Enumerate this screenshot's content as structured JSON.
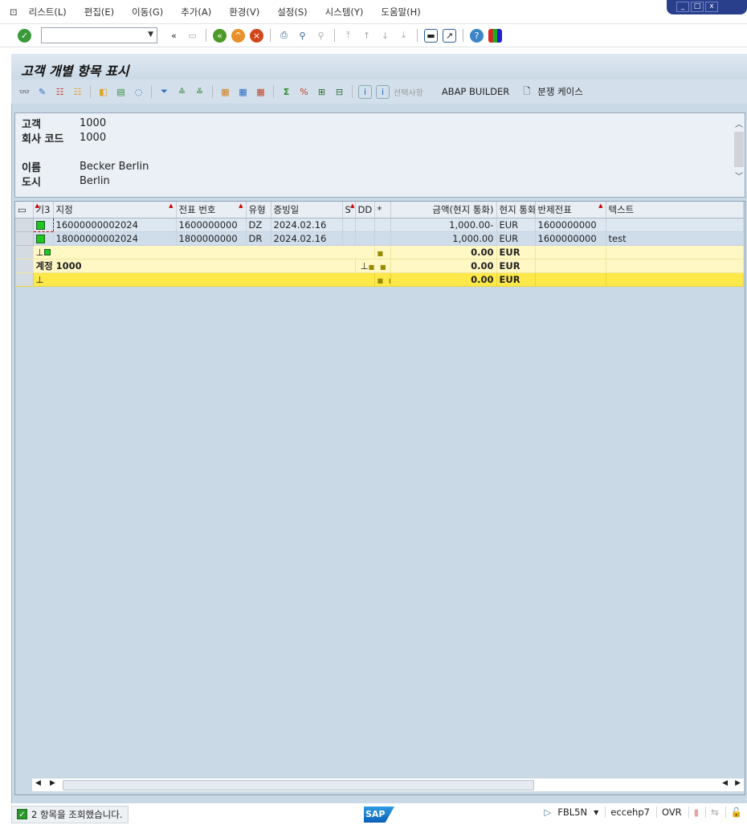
{
  "menu": {
    "items": [
      "리스트(L)",
      "편집(E)",
      "이동(G)",
      "추가(A)",
      "환경(V)",
      "설정(S)",
      "시스템(Y)",
      "도움말(H)"
    ]
  },
  "window_controls": [
    "_",
    "□",
    "x"
  ],
  "system_toolbar": {
    "command_field": "",
    "icons": [
      "enter-icon",
      "save-icon",
      "back-icon",
      "exit-icon",
      "cancel-icon",
      "print-icon",
      "find-icon",
      "find-next-icon",
      "first-page-icon",
      "prev-page-icon",
      "next-page-icon",
      "last-page-icon",
      "new-session-icon",
      "shortcut-icon",
      "help-icon",
      "layout-icon"
    ]
  },
  "title": "고객 개별 항목 표시",
  "app_toolbar": {
    "selections_label": "선택사항",
    "abap_builder_label": "ABAP BUILDER",
    "dispute_case_label": "분쟁 케이스"
  },
  "header": {
    "fields": [
      {
        "label": "고객",
        "value": "1000"
      },
      {
        "label": "회사 코드",
        "value": "1000"
      },
      {
        "label": "이름",
        "value": "Becker Berlin"
      },
      {
        "label": "도시",
        "value": "Berlin"
      }
    ]
  },
  "grid": {
    "columns": [
      "기3",
      "지정",
      "전표 번호",
      "유형",
      "증빙일",
      "S",
      "DD",
      "*",
      "금액(현지 통화)",
      "현지 통화",
      "반제전표",
      "텍스트"
    ],
    "rows": [
      {
        "assignment": "16000000002024",
        "doc_no": "1600000000",
        "type": "DZ",
        "doc_date": "2024.02.16",
        "amount": "1,000.00-",
        "currency": "EUR",
        "clearing_doc": "1600000000",
        "text": ""
      },
      {
        "assignment": "18000000002024",
        "doc_no": "1800000000",
        "type": "DR",
        "doc_date": "2024.02.16",
        "amount": "1,000.00",
        "currency": "EUR",
        "clearing_doc": "1600000000",
        "text": "test"
      }
    ],
    "subtotals": [
      {
        "label": "",
        "dots": "■",
        "amount": "0.00",
        "currency": "EUR"
      },
      {
        "label": "계정 1000",
        "dots": "■ ■",
        "amount": "0.00",
        "currency": "EUR"
      },
      {
        "label": "",
        "dots": "■ ■ ■",
        "amount": "0.00",
        "currency": "EUR"
      }
    ]
  },
  "status": {
    "message": "2 항목을 조회했습니다.",
    "transaction": "FBL5N",
    "server": "eccehp7",
    "mode": "OVR",
    "logo": "SAP"
  }
}
